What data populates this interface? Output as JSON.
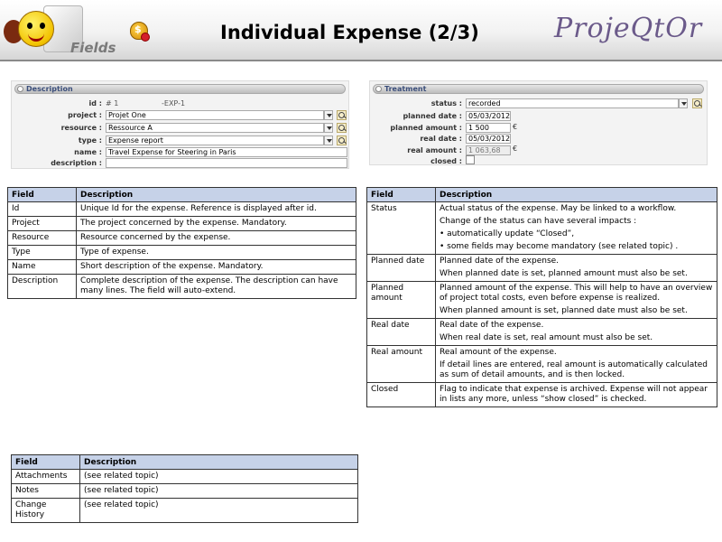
{
  "header": {
    "logo_text": "Fields",
    "title": "Individual Expense (2/3)",
    "brand": "ProjeQtOr"
  },
  "description_panel": {
    "title": "Description",
    "fields": {
      "id_label": "id :",
      "id_value": "# 1",
      "id_ref": "-EXP-1",
      "project_label": "project :",
      "project_value": "Projet One",
      "resource_label": "resource :",
      "resource_value": "Ressource A",
      "type_label": "type :",
      "type_value": "Expense report",
      "name_label": "name :",
      "name_value": "Travel Expense for Steering in Paris",
      "description_label": "description :",
      "description_value": ""
    }
  },
  "treatment_panel": {
    "title": "Treatment",
    "fields": {
      "status_label": "status :",
      "status_value": "recorded",
      "planned_date_label": "planned date :",
      "planned_date_value": "05/03/2012",
      "planned_amount_label": "planned amount :",
      "planned_amount_value": "1 500",
      "real_date_label": "real date :",
      "real_date_value": "05/03/2012",
      "real_amount_label": "real amount :",
      "real_amount_value": "1 063,68",
      "closed_label": "closed :",
      "currency": "€"
    }
  },
  "table_headers": {
    "field": "Field",
    "description": "Description"
  },
  "left_table": [
    {
      "field": "Id",
      "desc": [
        "Unique Id for the expense. Reference is displayed after id."
      ]
    },
    {
      "field": "Project",
      "desc": [
        "The project concerned by the expense. Mandatory."
      ]
    },
    {
      "field": "Resource",
      "desc": [
        "Resource concerned by the expense."
      ]
    },
    {
      "field": "Type",
      "desc": [
        "Type of expense."
      ]
    },
    {
      "field": "Name",
      "desc": [
        "Short description of the expense. Mandatory."
      ]
    },
    {
      "field": "Description",
      "desc": [
        "Complete description of the expense. The description can have many lines. The field will auto-extend."
      ]
    }
  ],
  "right_table": [
    {
      "field": "Status",
      "desc": [
        "Actual status of the expense. May be linked to a workflow.",
        "Change of the status can have several impacts :",
        "• automatically update “Closed”,",
        "• some fields may become mandatory (see related topic) ."
      ]
    },
    {
      "field": "Planned date",
      "desc": [
        "Planned date of the expense.",
        "When planned date is set, planned amount must also be set."
      ]
    },
    {
      "field": "Planned amount",
      "desc": [
        "Planned amount of the expense. This will help to have an overview of  project total costs, even before expense is realized.",
        "When planned amount is set, planned date must also be set."
      ]
    },
    {
      "field": "Real date",
      "desc": [
        "Real date of the expense.",
        "When real date is set, real amount must also be set."
      ]
    },
    {
      "field": "Real amount",
      "desc": [
        "Real amount of the expense.",
        "If detail lines are entered, real amount is automatically calculated as sum of detail amounts, and is then locked."
      ]
    },
    {
      "field": "Closed",
      "desc": [
        "Flag to indicate that expense is archived. Expense will not appear in lists any more, unless “show closed” is checked."
      ]
    }
  ],
  "bottom_table": [
    {
      "field": "Attachments",
      "desc": [
        "(see related topic)"
      ]
    },
    {
      "field": "Notes",
      "desc": [
        "(see related topic)"
      ]
    },
    {
      "field": "Change History",
      "desc": [
        "(see related topic)"
      ]
    }
  ]
}
